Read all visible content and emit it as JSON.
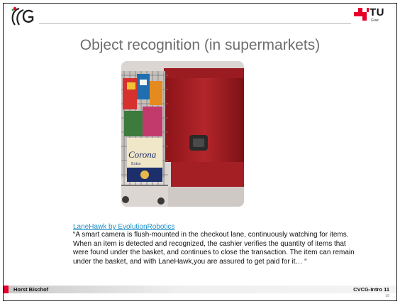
{
  "slide": {
    "title": "Object recognition (in supermarkets)",
    "link_text": "LaneHawk by EvolutionRobotics",
    "quote": "“A smart camera is flush-mounted in the checkout lane, continuously watching for items. When an item is detected and recognized, the cashier verifies the quantity of items that were found under the basket, and continues to close the transaction. The item can remain under the basket, and with LaneHawk,you are assured to get paid for it… “",
    "photo_text": {
      "brand": "Corona",
      "sub": "Extra"
    }
  },
  "branding": {
    "university_logo_text": "TU",
    "university_logo_sub": "Graz",
    "accent_color": "#e4002b"
  },
  "footer": {
    "author": "Horst Bischof",
    "course": "CVCG-Intro 11",
    "page": "38"
  }
}
